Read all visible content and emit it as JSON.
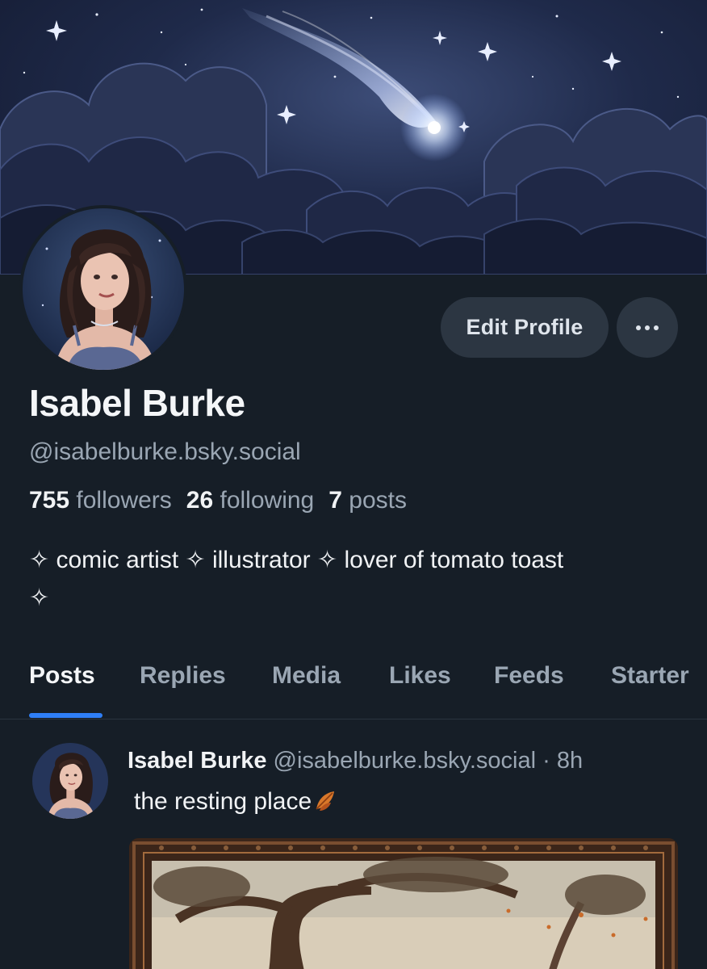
{
  "profile": {
    "name": "Isabel Burke",
    "handle": "@isabelburke.bsky.social",
    "bio_line1": "✧ comic artist ✧ illustrator ✧ lover of tomato toast",
    "bio_line2": "✧"
  },
  "stats": {
    "followers_count": "755",
    "followers_label": "followers",
    "following_count": "26",
    "following_label": "following",
    "posts_count": "7",
    "posts_label": "posts"
  },
  "actions": {
    "edit_label": "Edit Profile",
    "more_icon": "ellipsis-icon"
  },
  "tabs": [
    {
      "label": "Posts",
      "active": true
    },
    {
      "label": "Replies",
      "active": false
    },
    {
      "label": "Media",
      "active": false
    },
    {
      "label": "Likes",
      "active": false
    },
    {
      "label": "Feeds",
      "active": false
    },
    {
      "label": "Starter",
      "active": false
    }
  ],
  "post": {
    "author": "Isabel Burke",
    "handle": "@isabelburke.bsky.social",
    "separator": "·",
    "time": "8h",
    "text": "the resting place",
    "emoji_icon": "fallen-leaf-icon"
  },
  "colors": {
    "background": "#161e27",
    "button": "#2c3642",
    "accent": "#2f7ff7",
    "muted_text": "#9aa6b3"
  }
}
